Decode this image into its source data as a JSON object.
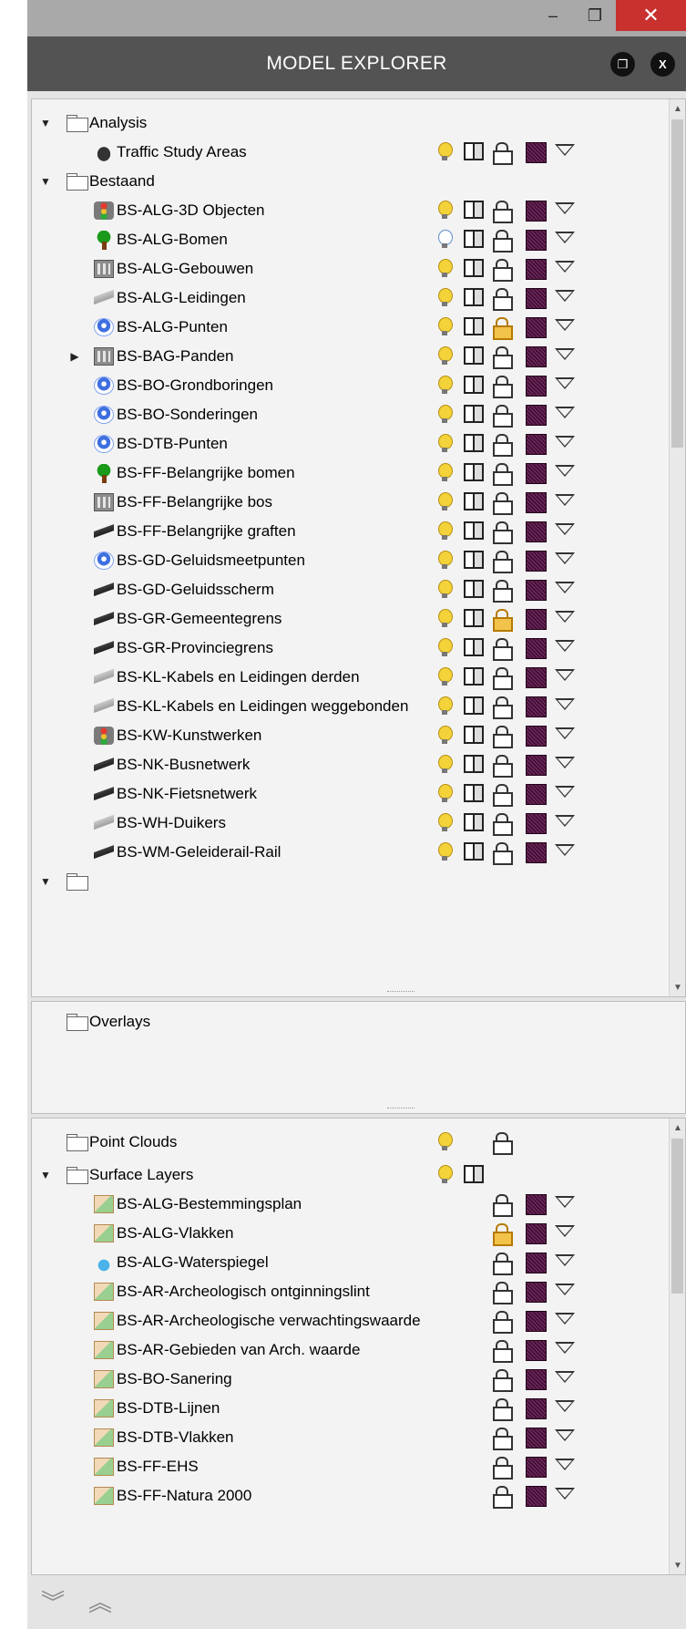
{
  "window": {
    "minimize_glyph": "–",
    "maximize_glyph": "❐",
    "close_glyph": "✕"
  },
  "header": {
    "title": "MODEL EXPLORER",
    "restore_glyph": "❐",
    "close_glyph": "X"
  },
  "tree": {
    "analysis_folder": "Analysis",
    "traffic_study_areas": "Traffic Study Areas",
    "bestaand_folder": "Bestaand",
    "layers": [
      "BS-ALG-3D Objecten",
      "BS-ALG-Bomen",
      "BS-ALG-Gebouwen",
      "BS-ALG-Leidingen",
      "BS-ALG-Punten",
      "BS-BAG-Panden",
      "BS-BO-Grondboringen",
      "BS-BO-Sonderingen",
      "BS-DTB-Punten",
      "BS-FF-Belangrijke bomen",
      "BS-FF-Belangrijke bos",
      "BS-FF-Belangrijke graften",
      "BS-GD-Geluidsmeetpunten",
      "BS-GD-Geluidsscherm",
      "BS-GR-Gemeentegrens",
      "BS-GR-Provinciegrens",
      "BS-KL-Kabels en Leidingen derden",
      "BS-KL-Kabels en Leidingen weggebonden",
      "BS-KW-Kunstwerken",
      "BS-NK-Busnetwerk",
      "BS-NK-Fietsnetwerk",
      "BS-WH-Duikers",
      "BS-WM-Geleiderail-Rail"
    ]
  },
  "overlays": {
    "folder": "Overlays"
  },
  "lower": {
    "point_clouds": "Point Clouds",
    "surface_layers": "Surface Layers",
    "surfaces": [
      "BS-ALG-Bestemmingsplan",
      "BS-ALG-Vlakken",
      "BS-ALG-Waterspiegel",
      "BS-AR-Archeologisch ontginningslint",
      "BS-AR-Archeologische verwachtingswaarde",
      "BS-AR-Gebieden van Arch. waarde",
      "BS-BO-Sanering",
      "BS-DTB-Lijnen",
      "BS-DTB-Vlakken",
      "BS-FF-EHS",
      "BS-FF-Natura 2000"
    ]
  },
  "footer": {
    "collapse_glyph": "︾",
    "expand_glyph": "︽"
  }
}
